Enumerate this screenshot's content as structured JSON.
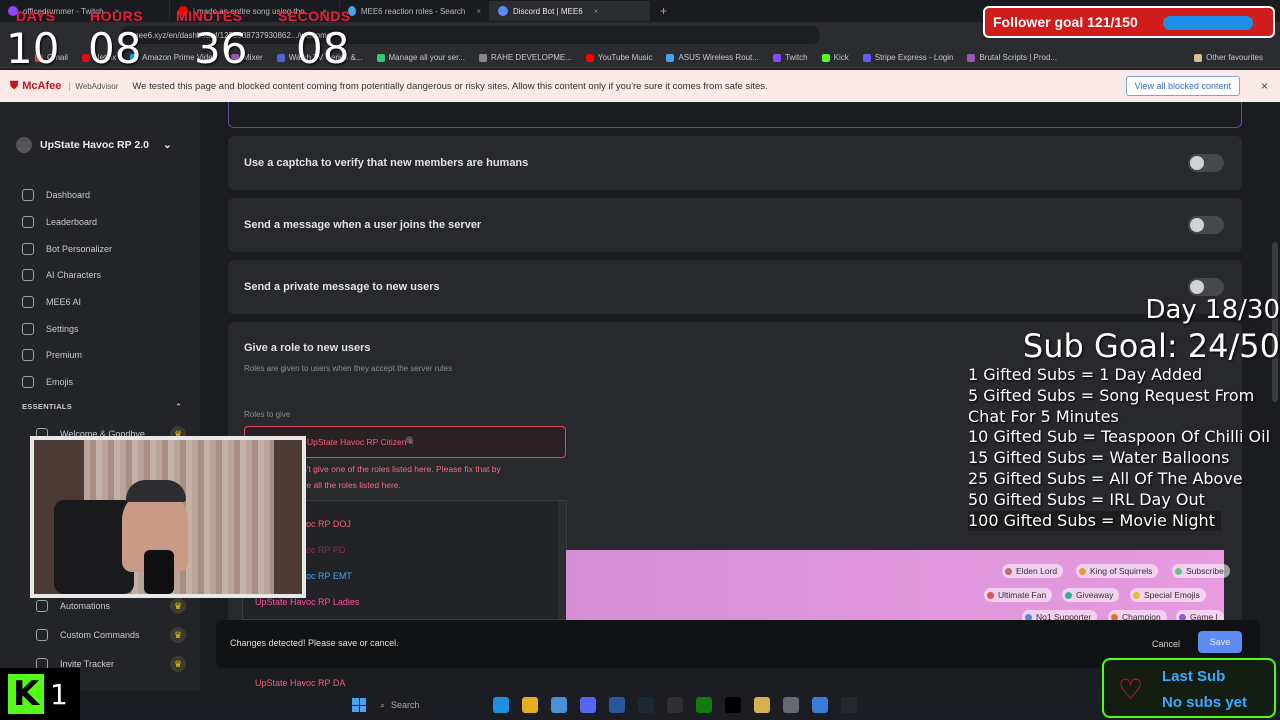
{
  "browser": {
    "tabs": [
      {
        "label": "officedrummer - Twitch",
        "color": "#9146ff"
      },
      {
        "label": "i made an entire song using the...",
        "color": "#ff0000"
      },
      {
        "label": "MEE6 reaction roles - Search",
        "color": "#4aa3f0"
      },
      {
        "label": "Discord Bot | MEE6",
        "color": "#5d8bf4"
      }
    ],
    "new_tab": "+",
    "url": "mee6.xyz/en/dashboard/1293538737930862.../welcome",
    "bookmarks": [
      {
        "label": "Gmail",
        "color": "#ea4335"
      },
      {
        "label": "Netflix",
        "color": "#e50914"
      },
      {
        "label": "Amazon Prime Video",
        "color": "#00a8e1"
      },
      {
        "label": "Mixer",
        "color": "#9b59b6"
      },
      {
        "label": "Watch TV Series &...",
        "color": "#4a66d8"
      },
      {
        "label": "Manage all your ser...",
        "color": "#2ecc71"
      },
      {
        "label": "RAHE DEVELOPME...",
        "color": "#888888"
      },
      {
        "label": "YouTube Music",
        "color": "#ff0000"
      },
      {
        "label": "ASUS Wireless Rout...",
        "color": "#4aa3f0"
      },
      {
        "label": "Twitch",
        "color": "#9146ff"
      },
      {
        "label": "Kick",
        "color": "#53fc18"
      },
      {
        "label": "Stripe Express - Login",
        "color": "#635bff"
      },
      {
        "label": "Brutal Scripts | Prod...",
        "color": "#9b59b6"
      }
    ],
    "other_favourites": "Other favourites"
  },
  "mcafee": {
    "brand": "McAfee",
    "product": "WebAdvisor",
    "message": "We tested this page and blocked content coming from potentially dangerous or risky sites. Allow this content only if you're sure it comes from safe sites.",
    "button": "View all blocked content",
    "close": "×"
  },
  "sidebar": {
    "server_name": "UpState Havoc RP 2.0",
    "items": [
      {
        "label": "Dashboard",
        "icon": "grid-icon"
      },
      {
        "label": "Leaderboard",
        "icon": "trophy-icon"
      },
      {
        "label": "Bot Personalizer",
        "icon": "bot-icon"
      },
      {
        "label": "AI Characters",
        "icon": "sparkle-icon"
      },
      {
        "label": "MEE6 AI",
        "icon": "ai-icon"
      },
      {
        "label": "Settings",
        "icon": "gear-icon"
      },
      {
        "label": "Premium",
        "icon": "premium-icon"
      },
      {
        "label": "Emojis",
        "icon": "emoji-icon"
      }
    ],
    "section_label": "ESSENTIALS",
    "essentials": [
      {
        "label": "Welcome & Goodbye"
      },
      {
        "label": "Automations"
      },
      {
        "label": "Custom Commands"
      },
      {
        "label": "Invite Tracker"
      }
    ]
  },
  "main": {
    "settings": [
      {
        "title": "Use a captcha to verify that new members are humans",
        "enabled": false
      },
      {
        "title": "Send a message when a user joins the server",
        "enabled": false
      },
      {
        "title": "Send a private message to new users",
        "enabled": false
      }
    ],
    "give_role": {
      "title": "Give a role to new users",
      "description": "Roles are given to users when they accept the server rules",
      "roles_label": "Roles to give",
      "selected_role": "UpState Havoc RP Citizen",
      "error_line1": "It looks like I can't give one of the roles listed here. Please fix that by",
      "error_line2": "moving me above all the roles listed here."
    },
    "dropdown_options": [
      {
        "label": "UpState Havoc RP DOJ",
        "color": "#ff5a7c"
      },
      {
        "label": "UpState Havoc RP PD",
        "color": "#8a2a55"
      },
      {
        "label": "UpState Havoc RP EMT",
        "color": "#3aa9ff"
      },
      {
        "label": "UpState Havoc RP Ladies",
        "color": "#ff4fa0"
      },
      {
        "label": "UpState Havoc RP DA",
        "color": "#ff5a7c"
      }
    ],
    "banner_roles": [
      {
        "label": "Elden Lord",
        "color": "#c06a6a"
      },
      {
        "label": "King of Squirrels",
        "color": "#e0a030"
      },
      {
        "label": "Subscribe",
        "color": "#6ac08a"
      },
      {
        "label": "Ultimate Fan",
        "color": "#e05050"
      },
      {
        "label": "Giveaway",
        "color": "#30b0a0"
      },
      {
        "label": "Special Emojis",
        "color": "#e0c030"
      },
      {
        "label": "No1 Supporter",
        "color": "#4a8ae0"
      },
      {
        "label": "Champion",
        "color": "#e07030"
      },
      {
        "label": "Game I",
        "color": "#8a5ae0"
      }
    ],
    "savebar": {
      "message": "Changes detected! Please save or cancel.",
      "cancel": "Cancel",
      "save": "Save"
    }
  },
  "overlay": {
    "timer": {
      "labels": [
        "DAYS",
        "HOURS",
        "MINUTES",
        "SECONDS"
      ],
      "values": [
        "10",
        "08",
        "36",
        "08"
      ]
    },
    "follower_goal": "Follower goal 121/150",
    "day": "Day 18/30",
    "sub_goal": "Sub Goal: 24/50",
    "gift_tiers": [
      "1 Gifted Subs = 1 Day Added",
      "5 Gifted Subs =  Song Request From Chat For 5 Minutes",
      "10 Gifted Sub = Teaspoon Of Chilli Oil",
      "15 Gifted Subs = Water Balloons",
      "25 Gifted Subs = All Of The Above",
      "50 Gifted Subs = IRL Day Out",
      "100 Gifted Subs = Movie Night"
    ],
    "kick_count": "1",
    "kick_letter": "K",
    "last_sub_title": "Last Sub",
    "last_sub_value": "No subs yet"
  },
  "taskbar": {
    "search": "Search",
    "icons": [
      "edge-icon",
      "chrome-icon",
      "explorer-icon",
      "discord-icon",
      "word-icon",
      "steam-icon",
      "obs-icon",
      "xbox-icon",
      "capcut-icon",
      "folder-icon",
      "settings-icon",
      "photos-icon",
      "github-icon"
    ]
  }
}
